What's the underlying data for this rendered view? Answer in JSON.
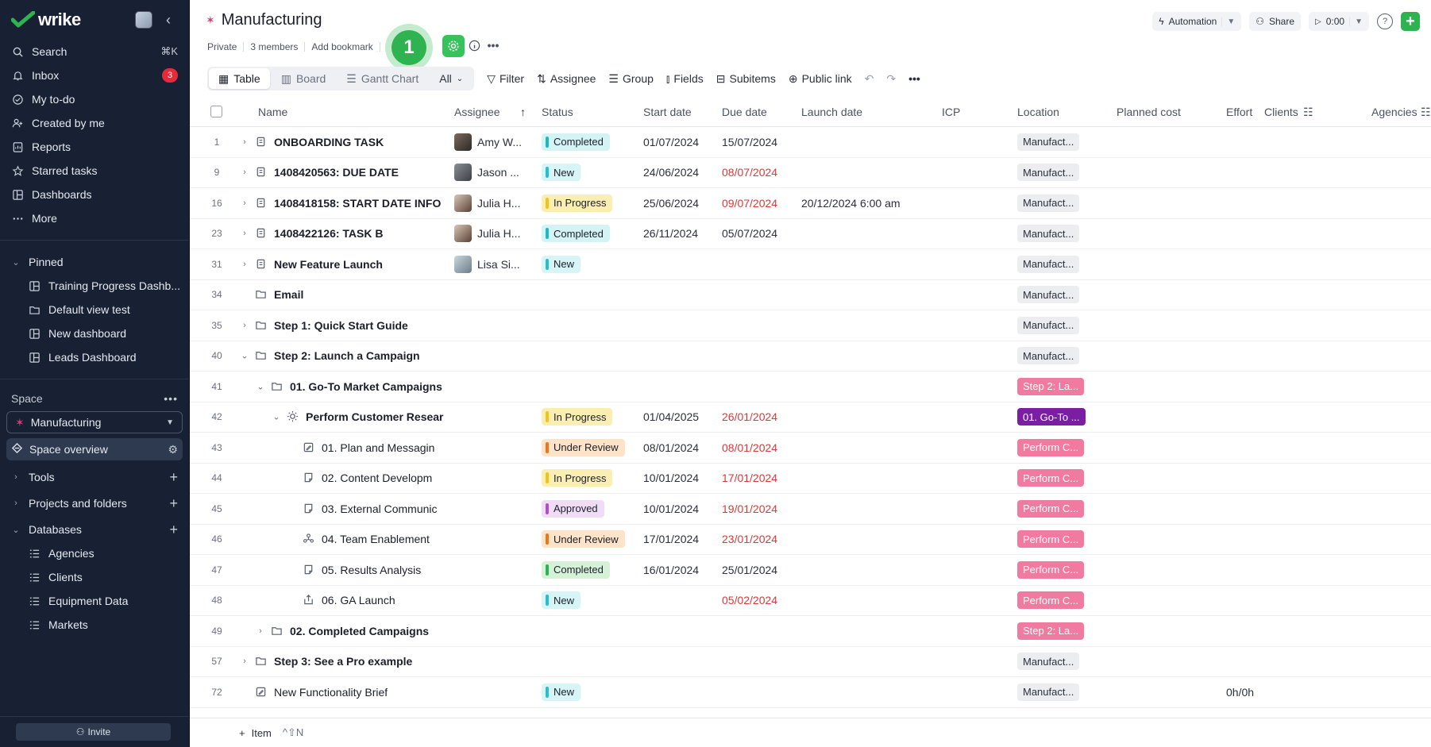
{
  "brand": "wrike",
  "sidebar": {
    "nav": [
      {
        "label": "Search",
        "icon": "search-icon",
        "shortcut": "⌘K"
      },
      {
        "label": "Inbox",
        "icon": "bell-icon",
        "badge": "3"
      },
      {
        "label": "My to-do",
        "icon": "check-circle-icon"
      },
      {
        "label": "Created by me",
        "icon": "user-plus-icon"
      },
      {
        "label": "Reports",
        "icon": "report-icon"
      },
      {
        "label": "Starred tasks",
        "icon": "star-icon"
      },
      {
        "label": "Dashboards",
        "icon": "dashboard-icon"
      },
      {
        "label": "More",
        "icon": "more-icon"
      }
    ],
    "pinned_label": "Pinned",
    "pinned": [
      {
        "label": "Training Progress Dashb...",
        "icon": "dashboard-icon"
      },
      {
        "label": "Default view test",
        "icon": "folder-icon"
      },
      {
        "label": "New dashboard",
        "icon": "dashboard-icon"
      },
      {
        "label": "Leads Dashboard",
        "icon": "dashboard-icon"
      }
    ],
    "space_label": "Space",
    "space_name": "Manufacturing",
    "space_overview": "Space overview",
    "tools": "Tools",
    "projects": "Projects and folders",
    "databases_label": "Databases",
    "databases": [
      "Agencies",
      "Clients",
      "Equipment Data",
      "Markets"
    ],
    "invite": "Invite"
  },
  "header": {
    "title": "Manufacturing",
    "privacy": "Private",
    "members": "3 members",
    "bookmark": "Add bookmark",
    "step_number": "1",
    "automation": "Automation",
    "share": "Share",
    "timer": "0:00"
  },
  "toolbar": {
    "tabs": [
      "Table",
      "Board",
      "Gantt Chart"
    ],
    "all": "All",
    "filter": "Filter",
    "assignee": "Assignee",
    "group": "Group",
    "fields": "Fields",
    "subitems": "Subitems",
    "public_link": "Public link"
  },
  "columns": {
    "name": "Name",
    "assignee": "Assignee",
    "status": "Status",
    "start": "Start date",
    "due": "Due date",
    "launch": "Launch date",
    "icp": "ICP",
    "location": "Location",
    "cost": "Planned cost",
    "effort": "Effort",
    "clients": "Clients",
    "agencies": "Agencies"
  },
  "rows": [
    {
      "num": "1",
      "name": "ONBOARDING TASK",
      "bold": true,
      "indent": 0,
      "expander": "›",
      "icon": "task",
      "assignee": "Amy W...",
      "status": "Completed",
      "status_key": "completed",
      "start": "01/07/2024",
      "due": "15/07/2024",
      "due_red": false,
      "launch": "",
      "location": "Manufact...",
      "loc_key": "gray",
      "effort": ""
    },
    {
      "num": "9",
      "name": "1408420563: DUE DATE",
      "bold": true,
      "indent": 0,
      "expander": "›",
      "icon": "task",
      "assignee": "Jason ...",
      "status": "New",
      "status_key": "new",
      "start": "24/06/2024",
      "due": "08/07/2024",
      "due_red": true,
      "launch": "",
      "location": "Manufact...",
      "loc_key": "gray",
      "effort": ""
    },
    {
      "num": "16",
      "name": "1408418158: START DATE INFO",
      "bold": true,
      "indent": 0,
      "expander": "›",
      "icon": "task",
      "assignee": "Julia H...",
      "status": "In Progress",
      "status_key": "inprogress",
      "start": "25/06/2024",
      "due": "09/07/2024",
      "due_red": true,
      "launch": "20/12/2024 6:00 am",
      "location": "Manufact...",
      "loc_key": "gray",
      "effort": ""
    },
    {
      "num": "23",
      "name": "1408422126: TASK B",
      "bold": true,
      "indent": 0,
      "expander": "›",
      "icon": "task",
      "assignee": "Julia H...",
      "status": "Completed",
      "status_key": "completed",
      "start": "26/11/2024",
      "due": "05/07/2024",
      "due_red": false,
      "launch": "",
      "location": "Manufact...",
      "loc_key": "gray",
      "effort": ""
    },
    {
      "num": "31",
      "name": "New Feature Launch",
      "bold": true,
      "indent": 0,
      "expander": "›",
      "icon": "task",
      "assignee": "Lisa Si...",
      "status": "New",
      "status_key": "new",
      "start": "",
      "due": "",
      "due_red": false,
      "launch": "",
      "location": "Manufact...",
      "loc_key": "gray",
      "effort": ""
    },
    {
      "num": "34",
      "name": "Email",
      "bold": true,
      "indent": 0,
      "expander": "",
      "icon": "folder",
      "assignee": "",
      "status": "",
      "status_key": "",
      "start": "",
      "due": "",
      "due_red": false,
      "launch": "",
      "location": "Manufact...",
      "loc_key": "gray",
      "effort": ""
    },
    {
      "num": "35",
      "name": "Step 1: Quick Start Guide",
      "bold": true,
      "indent": 0,
      "expander": "›",
      "icon": "folder",
      "assignee": "",
      "status": "",
      "status_key": "",
      "start": "",
      "due": "",
      "due_red": false,
      "launch": "",
      "location": "Manufact...",
      "loc_key": "gray",
      "effort": ""
    },
    {
      "num": "40",
      "name": "Step 2: Launch a Campaign",
      "bold": true,
      "indent": 0,
      "expander": "⌄",
      "icon": "folder",
      "assignee": "",
      "status": "",
      "status_key": "",
      "start": "",
      "due": "",
      "due_red": false,
      "launch": "",
      "location": "Manufact...",
      "loc_key": "gray",
      "effort": ""
    },
    {
      "num": "41",
      "name": "01. Go-To Market Campaigns",
      "bold": true,
      "indent": 1,
      "expander": "⌄",
      "icon": "folder",
      "assignee": "",
      "status": "",
      "status_key": "",
      "start": "",
      "due": "",
      "due_red": false,
      "launch": "",
      "location": "Step 2: La...",
      "loc_key": "pink",
      "effort": ""
    },
    {
      "num": "42",
      "name": "Perform Customer Resear",
      "bold": true,
      "indent": 2,
      "expander": "⌄",
      "icon": "sun",
      "assignee": "",
      "status": "In Progress",
      "status_key": "inprogress",
      "start": "01/04/2025",
      "due": "26/01/2024",
      "due_red": true,
      "launch": "",
      "location": "01. Go-To ...",
      "loc_key": "purple",
      "effort": ""
    },
    {
      "num": "43",
      "name": "01. Plan and Messagin",
      "bold": false,
      "indent": 3,
      "expander": "",
      "icon": "edit",
      "assignee": "",
      "status": "Under Review",
      "status_key": "review",
      "start": "08/01/2024",
      "due": "08/01/2024",
      "due_red": true,
      "launch": "",
      "location": "Perform C...",
      "loc_key": "pink",
      "effort": ""
    },
    {
      "num": "44",
      "name": "02. Content Developm",
      "bold": false,
      "indent": 3,
      "expander": "",
      "icon": "doc",
      "assignee": "",
      "status": "In Progress",
      "status_key": "inprogress",
      "start": "10/01/2024",
      "due": "17/01/2024",
      "due_red": true,
      "launch": "",
      "location": "Perform C...",
      "loc_key": "pink",
      "effort": ""
    },
    {
      "num": "45",
      "name": "03. External Communic",
      "bold": false,
      "indent": 3,
      "expander": "",
      "icon": "doc",
      "assignee": "",
      "status": "Approved",
      "status_key": "approved",
      "start": "10/01/2024",
      "due": "19/01/2024",
      "due_red": true,
      "launch": "",
      "location": "Perform C...",
      "loc_key": "pink",
      "effort": ""
    },
    {
      "num": "46",
      "name": "04. Team Enablement",
      "bold": false,
      "indent": 3,
      "expander": "",
      "icon": "team",
      "assignee": "",
      "status": "Under Review",
      "status_key": "review",
      "start": "17/01/2024",
      "due": "23/01/2024",
      "due_red": true,
      "launch": "",
      "location": "Perform C...",
      "loc_key": "pink",
      "effort": ""
    },
    {
      "num": "47",
      "name": "05. Results Analysis",
      "bold": false,
      "indent": 3,
      "expander": "",
      "icon": "doc",
      "assignee": "",
      "status": "Completed",
      "status_key": "completed_g",
      "start": "16/01/2024",
      "due": "25/01/2024",
      "due_red": false,
      "launch": "",
      "location": "Perform C...",
      "loc_key": "pink",
      "effort": ""
    },
    {
      "num": "48",
      "name": "06. GA Launch",
      "bold": false,
      "indent": 3,
      "expander": "",
      "icon": "share",
      "assignee": "",
      "status": "New",
      "status_key": "new",
      "start": "",
      "due": "05/02/2024",
      "due_red": true,
      "launch": "",
      "location": "Perform C...",
      "loc_key": "pink",
      "effort": ""
    },
    {
      "num": "49",
      "name": "02. Completed Campaigns",
      "bold": true,
      "indent": 1,
      "expander": "›",
      "icon": "folder",
      "assignee": "",
      "status": "",
      "status_key": "",
      "start": "",
      "due": "",
      "due_red": false,
      "launch": "",
      "location": "Step 2: La...",
      "loc_key": "pink",
      "effort": ""
    },
    {
      "num": "57",
      "name": "Step 3: See a Pro example",
      "bold": true,
      "indent": 0,
      "expander": "›",
      "icon": "folder",
      "assignee": "",
      "status": "",
      "status_key": "",
      "start": "",
      "due": "",
      "due_red": false,
      "launch": "",
      "location": "Manufact...",
      "loc_key": "gray",
      "effort": ""
    },
    {
      "num": "72",
      "name": "New Functionality Brief",
      "bold": false,
      "indent": 0,
      "expander": "",
      "icon": "edit",
      "assignee": "",
      "status": "New",
      "status_key": "new",
      "start": "",
      "due": "",
      "due_red": false,
      "launch": "",
      "location": "Manufact...",
      "loc_key": "gray",
      "effort": "0h/0h"
    }
  ],
  "bottom": {
    "item": "Item",
    "shortcut": "^⇧N"
  },
  "colors": {
    "sidebar": "#172133",
    "accent_green": "#2fb350",
    "completed": "#d4f3f5",
    "completed_bar": "#1fb7c4",
    "completed_g": "#d5f2d8",
    "completed_g_bar": "#2fb350",
    "new": "#d7f4f7",
    "new_bar": "#26bfcf",
    "inprogress": "#fbeeb3",
    "inprogress_bar": "#f0c21a",
    "review": "#fde3c7",
    "review_bar": "#e9781c",
    "approved": "#f1dcf6",
    "approved_bar": "#b04dc9",
    "loc_gray": "#ebedf0",
    "loc_pink": "#f07aa0",
    "loc_purple": "#7a1fa2"
  }
}
